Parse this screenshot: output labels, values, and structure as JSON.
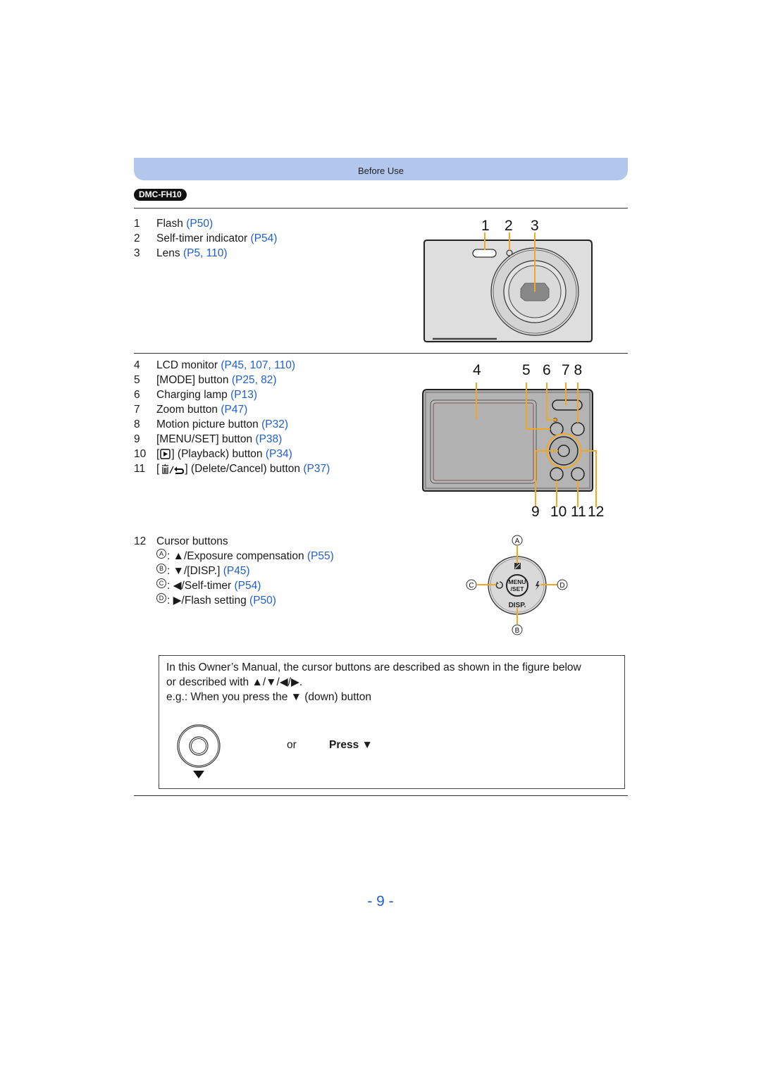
{
  "header": {
    "section_title": "Before Use"
  },
  "model_badge": "DMC-FH10",
  "front_section": {
    "items": [
      {
        "num": "1",
        "label": "Flash",
        "refs": "(P50)"
      },
      {
        "num": "2",
        "label": "Self-timer indicator",
        "refs": "(P54)"
      },
      {
        "num": "3",
        "label": "Lens",
        "refs": "(P5, 110)"
      }
    ],
    "callouts": [
      "1",
      "2",
      "3"
    ]
  },
  "back_section": {
    "items": [
      {
        "num": "4",
        "label": "LCD monitor",
        "refs": "(P45, 107, 110)"
      },
      {
        "num": "5",
        "label": "[MODE] button",
        "refs": "(P25, 82)"
      },
      {
        "num": "6",
        "label": "Charging lamp",
        "refs": "(P13)"
      },
      {
        "num": "7",
        "label": "Zoom button",
        "refs": "(P47)"
      },
      {
        "num": "8",
        "label": "Motion picture button",
        "refs": "(P32)"
      },
      {
        "num": "9",
        "label": "[MENU/SET] button",
        "refs": "(P38)"
      },
      {
        "num": "10",
        "label_pre": "[",
        "icon": "playback-icon",
        "label": "] (Playback) button",
        "refs": "(P34)"
      },
      {
        "num": "11",
        "label_pre": "[",
        "icon": "delete-cancel-icon",
        "label": "] (Delete/Cancel) button",
        "refs": "(P37)"
      }
    ],
    "callouts_top": [
      "4",
      "5",
      "6",
      "7 8"
    ],
    "callouts_bottom": [
      "9",
      "10",
      "11",
      "12"
    ]
  },
  "cursor_section": {
    "title_num": "12",
    "title": "Cursor buttons",
    "items": [
      {
        "key": "A",
        "arrow": "▲",
        "label": "/Exposure compensation",
        "refs": "(P55)"
      },
      {
        "key": "B",
        "arrow": "▼",
        "label": "/[DISP.]",
        "refs": "(P45)"
      },
      {
        "key": "C",
        "arrow": "◀",
        "label": "/Self-timer",
        "refs": "(P54)"
      },
      {
        "key": "D",
        "arrow": "▶",
        "label": "/Flash setting",
        "refs": "(P50)"
      }
    ],
    "diagram": {
      "center_top": "MENU",
      "center_bottom": "/SET",
      "bottom_label": "DISP.",
      "keys": [
        "A",
        "B",
        "C",
        "D"
      ]
    }
  },
  "note": {
    "line1": "In this Owner’s Manual, the cursor buttons are described as shown in the figure below",
    "line2": "or described with ▲/▼/◀/▶.",
    "line3": "e.g.: When you press the ▼ (down) button",
    "or_label": "or",
    "press_label": "Press ▼"
  },
  "page_number": "- 9 -",
  "colors": {
    "accent_link": "#1f5fd0",
    "header_bar": "#b3c6ec",
    "callout_line": "#f5a623"
  }
}
